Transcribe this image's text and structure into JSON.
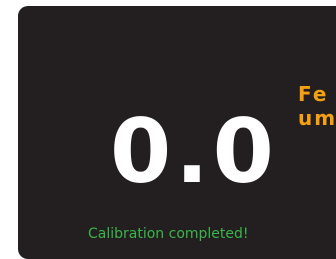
{
  "display": {
    "reading": "0.0",
    "unit_line1": "Fe",
    "unit_line2": "um",
    "status": "Calibration completed!"
  },
  "colors": {
    "panel_background": "#231f20",
    "reading": "#ffffff",
    "unit_label": "#f5a012",
    "status": "#39b54a"
  }
}
